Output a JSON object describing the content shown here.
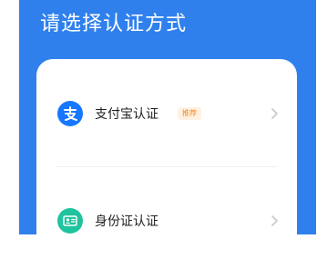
{
  "header": {
    "title": "请选择认证方式"
  },
  "options": [
    {
      "label": "支付宝认证",
      "badge": "推荐",
      "icon": "alipay-icon"
    },
    {
      "label": "身份证认证",
      "icon": "id-card-icon"
    }
  ],
  "colors": {
    "header_bg": "#2f80ed",
    "alipay_blue": "#1677ff",
    "idcard_green": "#1fc39d",
    "badge_text": "#f08a24",
    "badge_bg": "#fff1e2"
  }
}
